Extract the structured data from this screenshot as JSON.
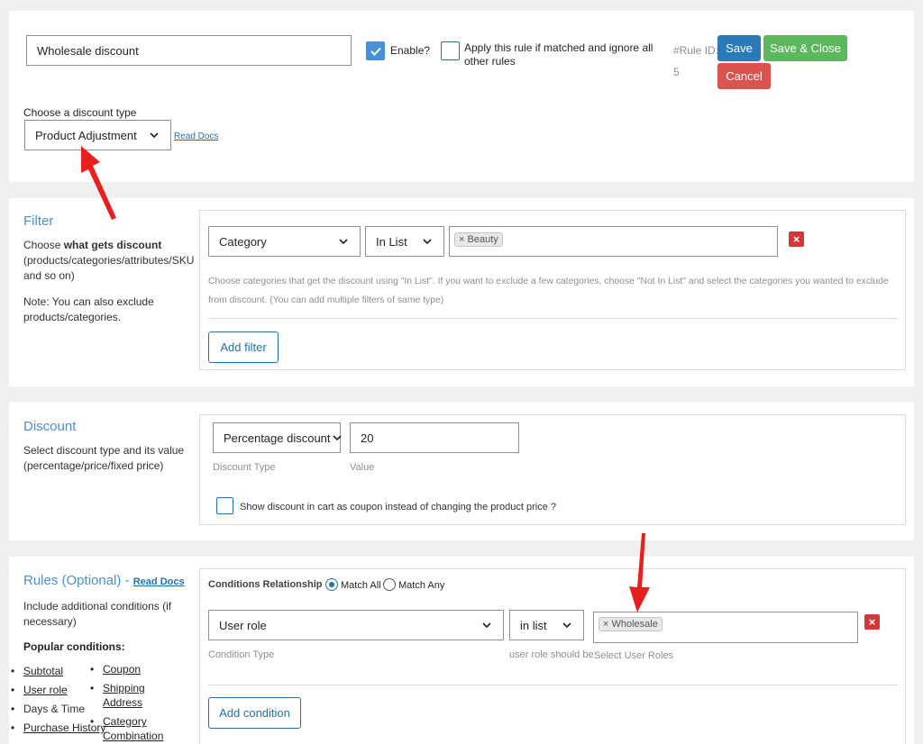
{
  "header": {
    "rule_name": "Wholesale discount",
    "enable_label": "Enable?",
    "apply_label_line1": "Apply this rule if matched and ignore all",
    "apply_label_line2": "other rules",
    "rule_id_label": "#Rule ID:",
    "rule_id_value": "5",
    "save_label": "Save",
    "save_close_label": "Save & Close",
    "cancel_label": "Cancel",
    "discount_type_label": "Choose a discount type",
    "discount_type_value": "Product Adjustment",
    "read_docs": "Read Docs",
    "enable_checked": true,
    "apply_checked": false
  },
  "filter": {
    "title": "Filter",
    "desc_prefix": "Choose ",
    "desc_bold": "what gets discount",
    "desc_line2": "(products/categories/attributes/SKU",
    "desc_line3": "and so on)",
    "note_line1": "Note: You can also exclude",
    "note_line2": "products/categories.",
    "type_value": "Category",
    "operator_value": "In List",
    "tag": "Beauty",
    "help_line1": "Choose categories that get the discount using \"In List\". If you want to exclude a few categories, choose \"Not In List\" and select the categories you wanted to exclude",
    "help_line2": "from discount. (You can add multiple filters of same type)",
    "add_button": "Add filter"
  },
  "discount": {
    "title": "Discount",
    "desc_line1": "Select discount type and its value",
    "desc_line2": "(percentage/price/fixed price)",
    "type_value": "Percentage discount",
    "value": "20",
    "type_hint": "Discount Type",
    "value_hint": "Value",
    "coupon_label": "Show discount in cart as coupon instead of changing the product price ?"
  },
  "rules": {
    "title": "Rules (Optional)",
    "dash": "-",
    "read_docs": "Read Docs",
    "desc_line1": "Include additional conditions (if",
    "desc_line2": "necessary)",
    "popular_label": "Popular conditions:",
    "col1": [
      "Subtotal",
      "User role",
      "Days & Time",
      "Purchase History"
    ],
    "col2_a": "Coupon",
    "col2_b1": "Shipping",
    "col2_b2": "Address",
    "col2_c1": "Category",
    "col2_c2": "Combination",
    "relationship_label": "Conditions Relationship",
    "match_all": "Match All",
    "match_any": "Match Any",
    "condition_type_value": "User role",
    "operator_value": "in list",
    "tag": "Wholesale",
    "condition_type_hint": "Condition Type",
    "operator_hint": "user role should be",
    "value_hint": "Select User Roles",
    "add_button": "Add condition"
  },
  "colors": {
    "accent": "#2271b1",
    "save": "#2a7ab9",
    "save_close": "#5cb85c",
    "cancel": "#d9534f",
    "annotation_arrow": "#e81f1f"
  }
}
